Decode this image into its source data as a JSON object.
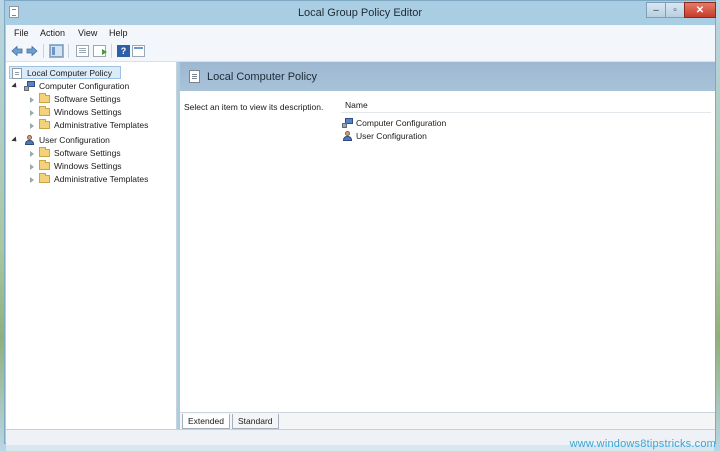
{
  "window": {
    "title": "Local Group Policy Editor"
  },
  "menu": [
    "File",
    "Action",
    "View",
    "Help"
  ],
  "tree": {
    "root": "Local Computer Policy",
    "items": [
      {
        "label": "Computer Configuration",
        "level": 1,
        "icon": "computer-icon",
        "expanded": true
      },
      {
        "label": "Software Settings",
        "level": 2,
        "icon": "folder-icon"
      },
      {
        "label": "Windows Settings",
        "level": 2,
        "icon": "folder-icon"
      },
      {
        "label": "Administrative Templates",
        "level": 2,
        "icon": "folder-icon"
      },
      {
        "label": "User Configuration",
        "level": 1,
        "icon": "user-icon",
        "expanded": true
      },
      {
        "label": "Software Settings",
        "level": 2,
        "icon": "folder-icon"
      },
      {
        "label": "Windows Settings",
        "level": 2,
        "icon": "folder-icon"
      },
      {
        "label": "Administrative Templates",
        "level": 2,
        "icon": "folder-icon"
      }
    ]
  },
  "details": {
    "title": "Local Computer Policy",
    "description": "Select an item to view its description.",
    "column": "Name",
    "items": [
      "Computer Configuration",
      "User Configuration"
    ]
  },
  "tabs": [
    "Extended",
    "Standard"
  ],
  "watermark": "www.windows8tipstricks.com"
}
